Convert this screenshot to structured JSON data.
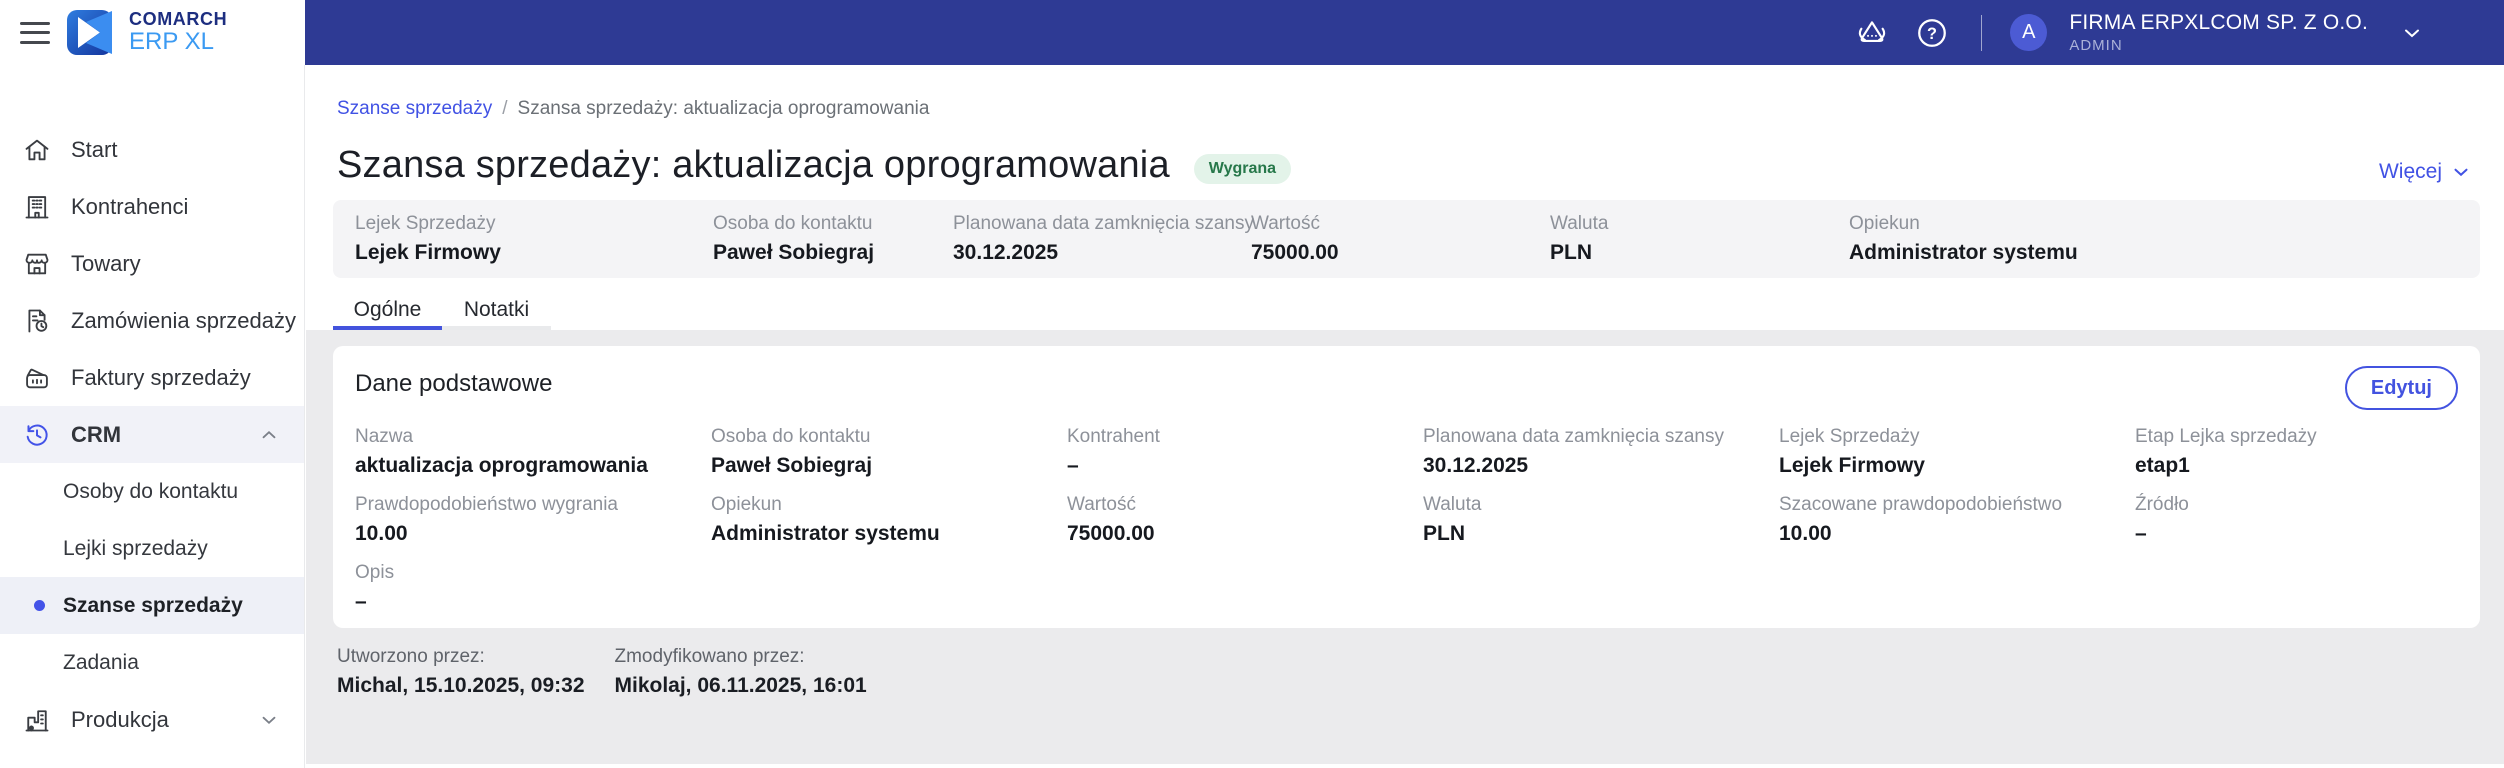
{
  "topbar": {
    "brand": {
      "line1": "COMARCH",
      "line2": "ERP XL"
    },
    "user": {
      "initial": "A",
      "company": "FIRMA ERPXLCOM SP. Z O.O.",
      "role": "ADMIN"
    }
  },
  "sidebar": {
    "items": [
      {
        "label": "Start",
        "icon": "home-icon"
      },
      {
        "label": "Kontrahenci",
        "icon": "building-icon"
      },
      {
        "label": "Towary",
        "icon": "store-icon"
      },
      {
        "label": "Zamówienia sprzedaży",
        "icon": "order-document-icon"
      },
      {
        "label": "Faktury sprzedaży",
        "icon": "invoice-wallet-icon"
      },
      {
        "label": "CRM",
        "icon": "history-clock-icon",
        "expanded": true,
        "children": [
          {
            "label": "Osoby do kontaktu",
            "active": false
          },
          {
            "label": "Lejki sprzedaży",
            "active": false
          },
          {
            "label": "Szanse sprzedaży",
            "active": true
          },
          {
            "label": "Zadania",
            "active": false
          }
        ]
      },
      {
        "label": "Produkcja",
        "icon": "factory-icon",
        "expanded": false
      }
    ]
  },
  "breadcrumb": {
    "link": "Szanse sprzedaży",
    "separator": "/",
    "current": "Szansa sprzedaży: aktualizacja oprogramowania"
  },
  "page": {
    "title": "Szansa sprzedaży: aktualizacja oprogramowania",
    "status_badge": "Wygrana",
    "more_label": "Więcej"
  },
  "summary": {
    "fields": [
      {
        "label": "Lejek Sprzedaży",
        "value": "Lejek Firmowy"
      },
      {
        "label": "Osoba do kontaktu",
        "value": "Paweł Sobiegraj"
      },
      {
        "label": "Planowana data zamknięcia szansy",
        "value": "30.12.2025"
      },
      {
        "label": "Wartość",
        "value": "75000.00"
      },
      {
        "label": "Waluta",
        "value": "PLN"
      },
      {
        "label": "Opiekun",
        "value": "Administrator systemu"
      }
    ]
  },
  "tabs": [
    {
      "label": "Ogólne",
      "active": true
    },
    {
      "label": "Notatki",
      "active": false
    }
  ],
  "card": {
    "title": "Dane podstawowe",
    "edit_button": "Edytuj",
    "row1": [
      {
        "label": "Nazwa",
        "value": "aktualizacja oprogramowania"
      },
      {
        "label": "Osoba do kontaktu",
        "value": "Paweł Sobiegraj"
      },
      {
        "label": "Kontrahent",
        "value": "–"
      },
      {
        "label": "Planowana data zamknięcia szansy",
        "value": "30.12.2025"
      },
      {
        "label": "Lejek Sprzedaży",
        "value": "Lejek Firmowy"
      },
      {
        "label": "Etap Lejka sprzedaży",
        "value": "etap1"
      }
    ],
    "row2": [
      {
        "label": "Prawdopodobieństwo wygrania",
        "value": "10.00"
      },
      {
        "label": "Opiekun",
        "value": "Administrator systemu"
      },
      {
        "label": "Wartość",
        "value": "75000.00"
      },
      {
        "label": "Waluta",
        "value": "PLN"
      },
      {
        "label": "Szacowane prawdopodobieństwo",
        "value": "10.00"
      },
      {
        "label": "Źródło",
        "value": "–"
      }
    ],
    "row3": [
      {
        "label": "Opis",
        "value": "–"
      }
    ]
  },
  "audit": {
    "created_label": "Utworzono przez:",
    "created_value": "Michal, 15.10.2025, 09:32",
    "modified_label": "Zmodyfikowano przez:",
    "modified_value": "Mikolaj, 06.11.2025, 16:01"
  },
  "colors": {
    "topbar": "#2e3a94",
    "accent": "#4353e0",
    "link": "#4152e4",
    "badge_bg": "#e3f3e9",
    "badge_text": "#27784a",
    "panel_gray": "#ebebed",
    "summary_gray": "#f4f4f6",
    "label_gray": "#8d9199"
  }
}
